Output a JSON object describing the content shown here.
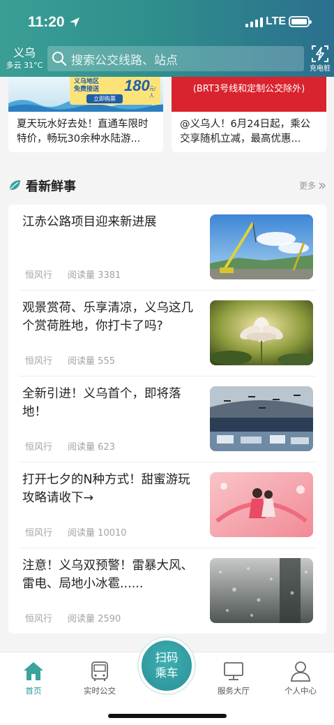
{
  "status_bar": {
    "time": "11:20",
    "network": "LTE"
  },
  "header": {
    "city": "义乌",
    "weather": "多云 31°C",
    "search_placeholder": "搜索公交线路、站点",
    "charge_label": "充电桩"
  },
  "banners": [
    {
      "title": "夏天玩水好去处！直通车限时特价，畅玩30余种水陆游...",
      "promo_line1": "义乌地区",
      "promo_line2": "免费接送",
      "promo_number": "180",
      "promo_unit": "元/人",
      "promo_button": "立即购票"
    },
    {
      "title": "@义乌人！6月24日起，乘公交享随机立减，最高优惠...",
      "banner_text": "(BRT3号线和定制公交除外)"
    }
  ],
  "section": {
    "title": "看新鲜事",
    "more": "更多"
  },
  "news": [
    {
      "title": "江赤公路项目迎来新进展",
      "source": "恒风行",
      "reads_label": "阅读量",
      "reads": "3381",
      "thumb": "construction-crane"
    },
    {
      "title": "观景赏荷、乐享清凉，义乌这几个赏荷胜地，你打卡了吗?",
      "source": "恒风行",
      "reads_label": "阅读量",
      "reads": "555",
      "thumb": "lotus-flower"
    },
    {
      "title": "全新引进！义乌首个，即将落地！",
      "source": "恒风行",
      "reads_label": "阅读量",
      "reads": "623",
      "thumb": "drones-stadium"
    },
    {
      "title": "打开七夕的N种方式！甜蜜游玩攻略请收下→",
      "source": "恒风行",
      "reads_label": "阅读量",
      "reads": "10010",
      "thumb": "qixi-couple"
    },
    {
      "title": "注意！义乌双预警！雷暴大风、雷电、局地小冰雹......",
      "source": "恒风行",
      "reads_label": "阅读量",
      "reads": "2590",
      "thumb": "rain-window"
    }
  ],
  "tabbar": {
    "home": "首页",
    "realtime_bus": "实时公交",
    "scan_line1": "扫码",
    "scan_line2": "乘车",
    "service_hall": "服务大厅",
    "profile": "个人中心"
  },
  "colors": {
    "header_start": "#3a9e96",
    "header_end": "#2b6f8e",
    "accent": "#2e9a9c",
    "banner_red": "#d9232e"
  }
}
